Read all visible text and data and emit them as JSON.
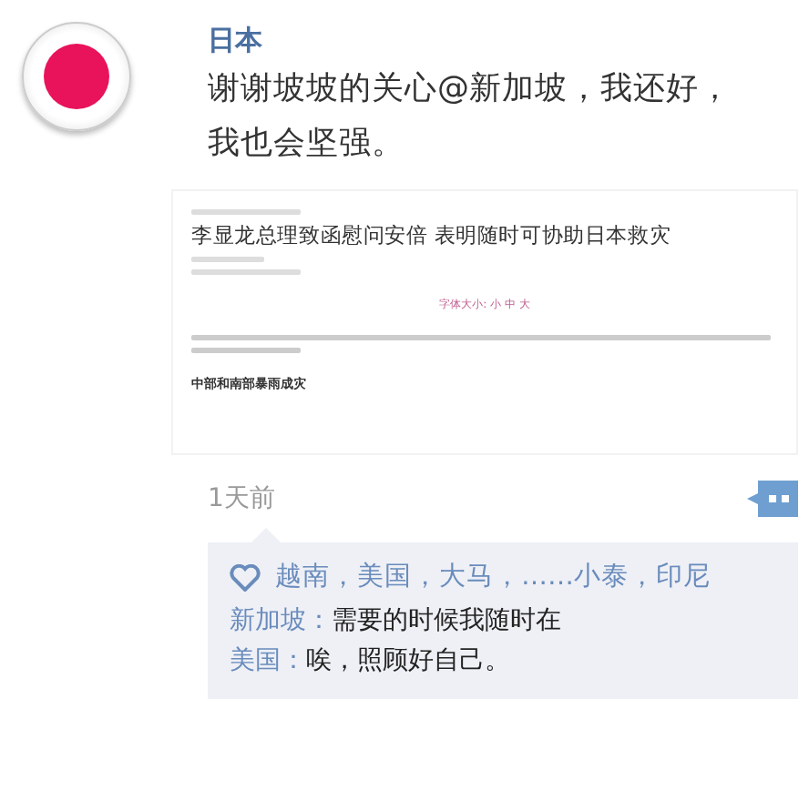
{
  "post": {
    "author": "日本",
    "text": "谢谢坡坡的关心@新加坡，我还好，我也会坚强。",
    "attachment": {
      "headline": "李显龙总理致函慰问安倍 表明随时可协助日本救灾",
      "font_size_label": "字体大小: 小 中 大",
      "subheading": "中部和南部暴雨成灾"
    },
    "time": "1天前",
    "likes": "越南，美国，大马，……小泰，印尼",
    "comments": [
      {
        "author": "新加坡",
        "separator": "：",
        "text": "需要的时候我随时在"
      },
      {
        "author": "美国",
        "separator": "：",
        "text": "唉，照顾好自己。"
      }
    ]
  }
}
